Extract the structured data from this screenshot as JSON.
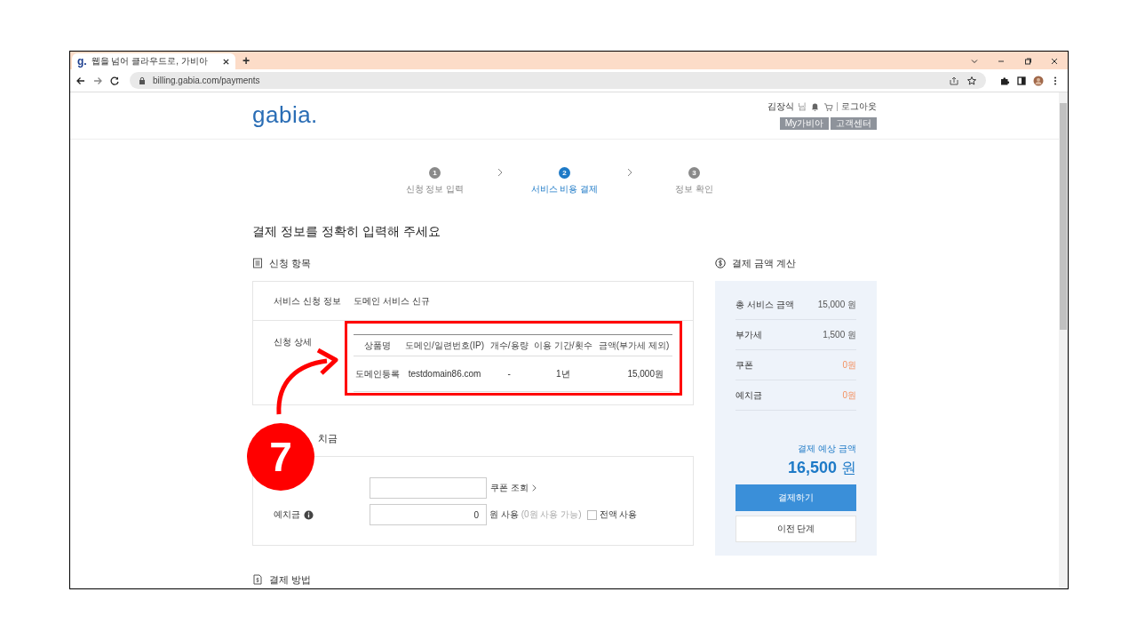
{
  "browser": {
    "favicon": "g.",
    "tab_title": "웹을 넘어 클라우드로, 가비아",
    "new_tab": "+",
    "url": "billing.gabia.com/payments"
  },
  "header": {
    "logo": "gabia.",
    "user_name": "김장식",
    "user_suffix": "님",
    "logout": "로그아웃",
    "buttons": [
      "My가비아",
      "고객센터"
    ]
  },
  "steps": [
    {
      "number": "1",
      "label": "신청 정보 입력",
      "selected": false
    },
    {
      "number": "2",
      "label": "서비스 비용 결제",
      "selected": true
    },
    {
      "number": "3",
      "label": "정보 확인",
      "selected": false
    }
  ],
  "heading": "결제 정보를 정확히 입력해 주세요",
  "order": {
    "title": "신청 항목",
    "service_label": "서비스 신청 정보",
    "service_value": "도메인 서비스 신규",
    "detail_label": "신청 상세",
    "columns": [
      "상품명",
      "도메인/일련번호(IP)",
      "개수/용량",
      "이용 기간/횟수",
      "금액(부가세 제외)"
    ],
    "rows": [
      [
        "도메인등록",
        "testdomain86.com",
        "-",
        "1년",
        "15,000원"
      ]
    ]
  },
  "discount": {
    "title": "치금",
    "coupon_lookup": "쿠폰 조회",
    "deposit_label": "예치금",
    "deposit_value": "0",
    "deposit_unit": "원 사용",
    "deposit_available": "(0원 사용 가능)",
    "full_use": {
      "label": "전액 사용",
      "checked": false
    }
  },
  "payment_method": {
    "title": "결제 방법"
  },
  "summary": {
    "title": "결제 금액 계산",
    "rows": [
      {
        "label": "총 서비스 금액",
        "value": "15,000 원",
        "kind": "charge"
      },
      {
        "label": "부가세",
        "value": "1,500 원",
        "kind": "charge"
      },
      {
        "label": "쿠폰",
        "value": "0원",
        "kind": "discount"
      },
      {
        "label": "예치금",
        "value": "0원",
        "kind": "discount"
      }
    ],
    "total_label": "결제 예상 금액",
    "total_value": "16,500",
    "total_unit": "원",
    "pay_button": "결제하기",
    "back_button": "이전 단계"
  },
  "annotation": {
    "badge": "7"
  }
}
